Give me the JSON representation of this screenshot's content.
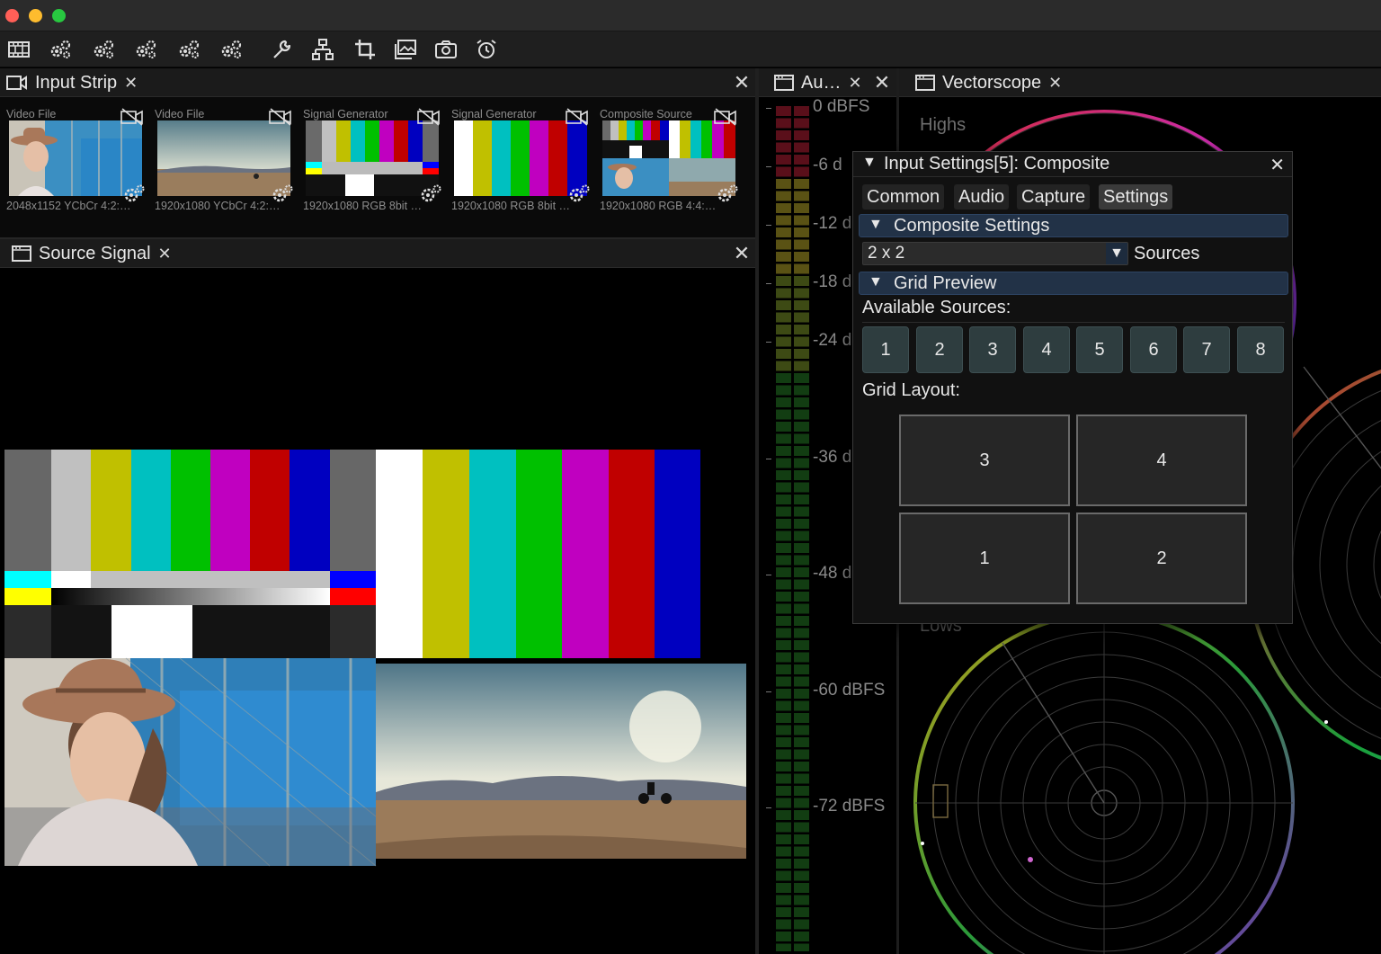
{
  "window": {
    "traffic_colors": [
      "#ff5f57",
      "#febc2e",
      "#28c840"
    ]
  },
  "toolbar": {
    "icons": [
      "filmstrip-icon",
      "gears-icon",
      "gears-icon",
      "gears-icon",
      "gears-icon",
      "gears-icon",
      "wrench-icon",
      "network-icon",
      "crop-icon",
      "images-icon",
      "camera-icon",
      "alarm-clock-icon"
    ]
  },
  "input_strip": {
    "tab_label": "Input Strip",
    "items": [
      {
        "type": "Video File",
        "format": "2048x1152 YCbCr 4:2:…"
      },
      {
        "type": "Video File",
        "format": "1920x1080 YCbCr 4:2:…"
      },
      {
        "type": "Signal Generator",
        "format": "1920x1080 RGB 8bit …"
      },
      {
        "type": "Signal Generator",
        "format": "1920x1080 RGB 8bit …"
      },
      {
        "type": "Composite Source",
        "format": "1920x1080 RGB 4:4:…"
      }
    ]
  },
  "source_signal": {
    "tab_label": "Source Signal"
  },
  "audio": {
    "tab_label": "Au…",
    "scale": [
      "0 dBFS",
      "-6 d",
      "-12 d",
      "-18 d",
      "-24 d",
      "-36 d",
      "-48 d",
      "-60 dBFS",
      "-72 dBFS"
    ]
  },
  "vectorscope": {
    "tab_label": "Vectorscope",
    "labels": {
      "highs": "Highs",
      "lows": "Lows"
    }
  },
  "dialog": {
    "title": "Input Settings[5]: Composite",
    "tabs": [
      "Common",
      "Audio",
      "Capture",
      "Settings"
    ],
    "active_tab": "Settings",
    "composite_section": "Composite Settings",
    "grid_select": "2 x 2",
    "grid_select_label": "Sources",
    "grid_preview_section": "Grid Preview",
    "available_sources_label": "Available Sources:",
    "sources": [
      "1",
      "2",
      "3",
      "4",
      "5",
      "6",
      "7",
      "8"
    ],
    "grid_layout_label": "Grid Layout:",
    "grid_layout": [
      "3",
      "4",
      "1",
      "2"
    ]
  },
  "colors": {
    "section_bg": "#223247",
    "source_button_bg": "#2e3d3f"
  }
}
